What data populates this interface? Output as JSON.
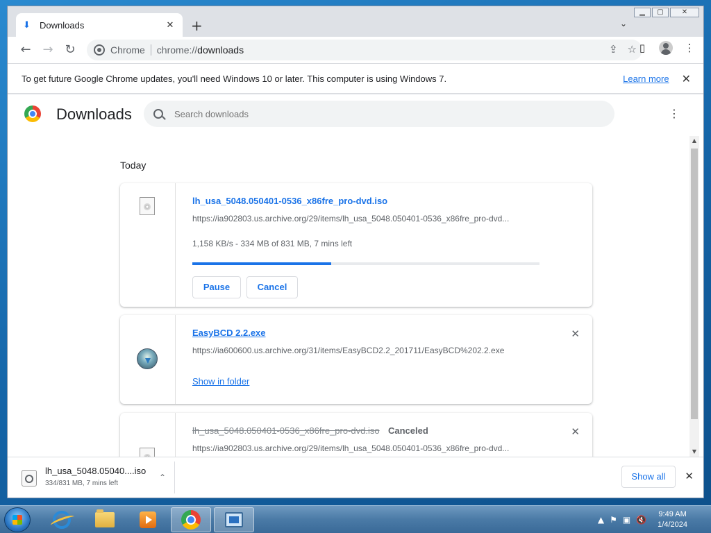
{
  "tab": {
    "title": "Downloads"
  },
  "toolbar": {
    "scheme_label": "Chrome",
    "url_prefix": "chrome://",
    "url_path": "downloads"
  },
  "infobar": {
    "message": "To get future Google Chrome updates, you'll need Windows 10 or later. This computer is using Windows 7.",
    "link": "Learn more"
  },
  "page": {
    "title": "Downloads",
    "search_placeholder": "Search downloads",
    "date_header": "Today"
  },
  "downloads": [
    {
      "name": "lh_usa_5048.050401-0536_x86fre_pro-dvd.iso",
      "url": "https://ia902803.us.archive.org/29/items/lh_usa_5048.050401-0536_x86fre_pro-dvd...",
      "status": "1,158 KB/s - 334 MB of 831 MB, 7 mins left",
      "progress_fraction": 0.4,
      "pause_label": "Pause",
      "cancel_label": "Cancel"
    },
    {
      "name": "EasyBCD 2.2.exe",
      "url": "https://ia600600.us.archive.org/31/items/EasyBCD2.2_201711/EasyBCD%202.2.exe",
      "link_label": "Show in folder"
    },
    {
      "name": "lh_usa_5048.050401-0536_x86fre_pro-dvd.iso",
      "status_tag": "Canceled",
      "url": "https://ia902803.us.archive.org/29/items/lh_usa_5048.050401-0536_x86fre_pro-dvd..."
    }
  ],
  "shelf": {
    "file_name": "lh_usa_5048.05040....iso",
    "status": "334/831 MB, 7 mins left",
    "show_all_label": "Show all"
  },
  "taskbar": {
    "time": "9:49 AM",
    "date": "1/4/2024"
  },
  "colors": {
    "accent": "#1a73e8",
    "progress_track": "#e8eaed"
  }
}
